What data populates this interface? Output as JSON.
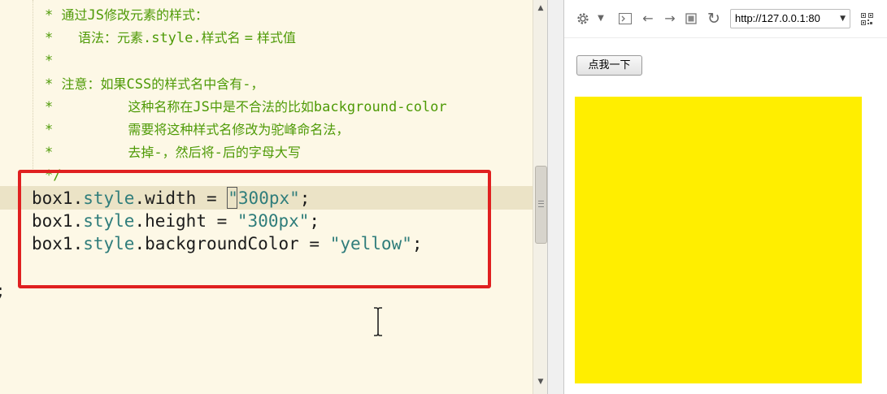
{
  "editor": {
    "comment_lines": [
      {
        "star": "* ",
        "text": "通过",
        "mono": "JS",
        "rest": "修改元素的样式："
      },
      {
        "star": "*   ",
        "text": "语法：元素",
        "mono": ".style.",
        "rest": "样式名 ",
        "mono2": "=",
        "rest2": " 样式值"
      },
      {
        "star": "*"
      },
      {
        "star": "* ",
        "text": "注意：如果",
        "mono": "CSS",
        "rest": "的样式名中含有",
        "mono2": "-",
        "rest2": "，"
      },
      {
        "star": "*         ",
        "text": "这种名称在",
        "mono": "JS",
        "rest": "中是不合法的比如",
        "mono2": "background-color"
      },
      {
        "star": "*         ",
        "text": "需要将这种样式名修改为驼峰命名法，"
      },
      {
        "star": "*         ",
        "text": "去掉",
        "mono": "-",
        "rest": "，然后将",
        "mono2": "-",
        "rest2": "后的字母大写"
      },
      {
        "star": "*/"
      }
    ],
    "code_lines": [
      {
        "obj": "box1",
        "dot1": ".",
        "kw": "style",
        "dot2": ".",
        "prop": "width",
        "op": " = ",
        "str": "\"300px\"",
        "end": ";"
      },
      {
        "obj": "box1",
        "dot1": ".",
        "kw": "style",
        "dot2": ".",
        "prop": "height",
        "op": " = ",
        "str": "\"300px\"",
        "end": ";"
      },
      {
        "obj": "box1",
        "dot1": ".",
        "kw": "style",
        "dot2": ".",
        "prop": "backgroundColor",
        "op": " = ",
        "str": "\"yellow\"",
        "end": ";"
      }
    ],
    "closing_semicolon": ";",
    "colors": {
      "background": "#fdf8e6",
      "comment": "#4e9a06",
      "keyword": "#2f7d7b",
      "highlight_border": "#e02020"
    }
  },
  "browser": {
    "toolbar": {
      "gear_icon": "gear-icon",
      "dropdown_icon": "chevron-down-icon",
      "console_icon": "console-icon",
      "back_icon": "back-arrow-icon",
      "forward_icon": "forward-arrow-icon",
      "stop_icon": "stop-icon",
      "refresh_icon": "refresh-icon",
      "qr_icon": "qr-code-icon",
      "url": "http://127.0.0.1:80"
    },
    "button_label": "点我一下",
    "box_color": "#ffee00"
  }
}
